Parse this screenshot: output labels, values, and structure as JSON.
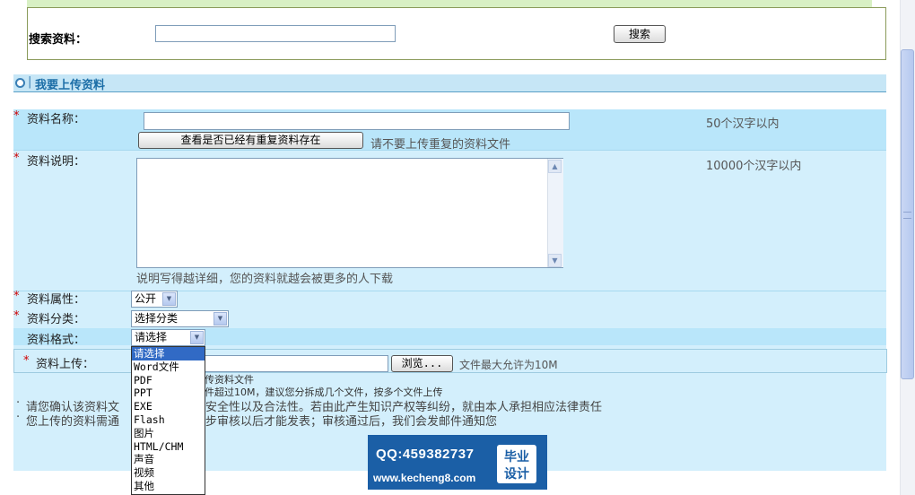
{
  "search": {
    "label": "搜索资料：",
    "input_value": "",
    "button": "搜索"
  },
  "section": {
    "separator": "|",
    "title": "我要上传资料"
  },
  "form": {
    "required_mark": "*",
    "name": {
      "label": "资料名称：",
      "value": "",
      "hint": "50个汉字以内",
      "check_button": "查看是否已经有重复资料存在",
      "check_hint": "请不要上传重复的资料文件"
    },
    "description": {
      "label": "资料说明：",
      "value": "",
      "hint": "10000个汉字以内",
      "bottom_hint": "说明写得越详细，您的资料就越会被更多的人下载"
    },
    "attribute": {
      "label": "资料属性：",
      "selected": "公开"
    },
    "category": {
      "label": "资料分类：",
      "selected": "选择分类"
    },
    "format": {
      "label": "资料格式：",
      "selected": "请选择",
      "options": [
        "请选择",
        "Word文件",
        "PDF",
        "PPT",
        "EXE",
        "Flash",
        "图片",
        "HTML/CHM",
        "声音",
        "视频",
        "其他"
      ]
    },
    "upload": {
      "label": "资料上传：",
      "browse_button": "浏览...",
      "size_hint": "文件最大允许为10M"
    },
    "notes": {
      "line1_tail": "传资料文件",
      "line2_tail": "件超过10M，建议您分拆成几个文件，按多个文件上传",
      "notice1_head": "请您确认该资料文",
      "notice1_tail": "安全性以及合法性。若由此产生知识产权等纠纷，就由本人承担相应法律责任",
      "notice2_head": "您上传的资料需通",
      "notice2_tail": "步审核以后才能发表；审核通过后，我们会发邮件通知您",
      "bullet": "·"
    }
  },
  "watermark": {
    "qq": "QQ:459382737",
    "url": "www.kecheng8.com",
    "badge_line1": "毕业",
    "badge_line2": "设计"
  },
  "colors": {
    "header_bg": "#c6e6f6",
    "row_dark": "#b9e6fa",
    "row_light": "#d3effc",
    "title_blue": "#1c6ea7",
    "required_red": "#d00000",
    "dropdown_highlight": "#316ac5",
    "watermark_blue": "#1b5fa6"
  },
  "icons": {
    "section_bullet": "circle-icon",
    "select_arrow": "chevron-down-icon"
  }
}
